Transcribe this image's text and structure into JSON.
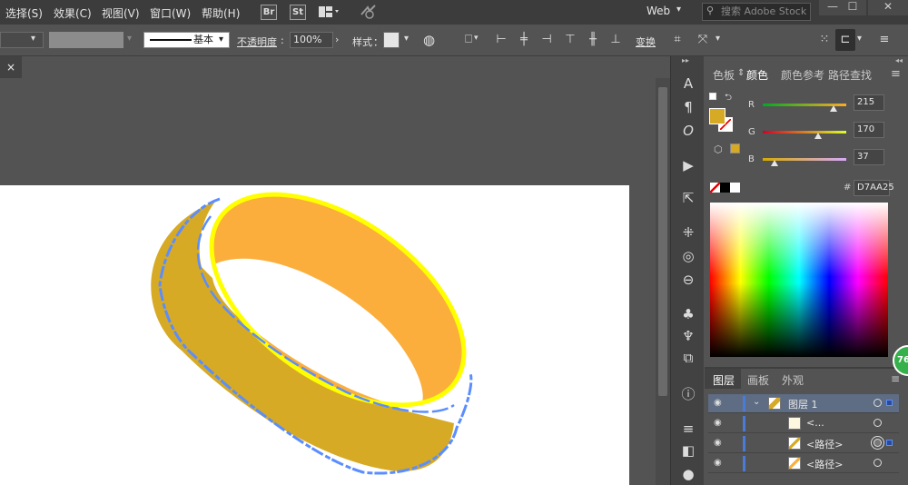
{
  "menu": [
    "选择(S)",
    "效果(C)",
    "视图(V)",
    "窗口(W)",
    "帮助(H)"
  ],
  "app_icons": [
    "Br",
    "St"
  ],
  "workspace": "Web",
  "search": {
    "placeholder": "搜索 Adobe Stock"
  },
  "window_controls": [
    "—",
    "☐",
    "✕"
  ],
  "control_bar": {
    "stroke_profile": "基本",
    "opacity_label": "不透明度",
    "opacity_colon": ":",
    "opacity_value": "100%",
    "style_label": "样式",
    "style_colon": "：",
    "transform_label": "变换"
  },
  "doc_tab_close": "×",
  "panel": {
    "collapse_arrows": "◂◂",
    "tabs": [
      "色板",
      "颜色",
      "颜色参考",
      "路径查找"
    ],
    "active_tab": "颜色",
    "channels": [
      {
        "name": "R",
        "value": "215",
        "fraction": 0.843
      },
      {
        "name": "G",
        "value": "170",
        "fraction": 0.667
      },
      {
        "name": "B",
        "value": "37",
        "fraction": 0.145
      }
    ],
    "hex_label": "#",
    "hex_value": "D7AA25",
    "fill_color": "#D7AA25"
  },
  "layers_panel": {
    "tabs": [
      "图层",
      "画板",
      "外观"
    ],
    "rows": [
      {
        "name": "图层 1",
        "selected": true
      },
      {
        "name": "<...",
        "selected": false
      },
      {
        "name": "<路径>",
        "selected": false
      },
      {
        "name": "<路径>",
        "selected": false
      }
    ]
  },
  "badge": "76",
  "colors": {
    "ring_outer": "#D7AA25",
    "ring_inner": "#FBAE3C",
    "highlight_yellow": "#FFFF00",
    "selection_blue": "#5A8DFF"
  }
}
